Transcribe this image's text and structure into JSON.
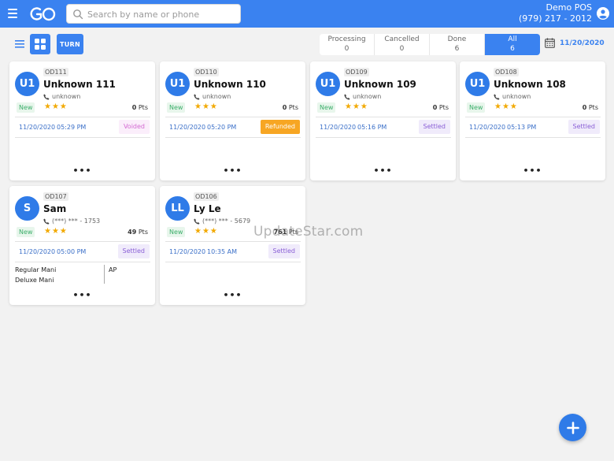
{
  "header": {
    "search_placeholder": "Search by name or phone",
    "store_name": "Demo POS",
    "store_phone": "(979) 217 - 2012"
  },
  "toolbar": {
    "turn_label": "TURN",
    "tabs": [
      {
        "label": "Processing",
        "count": "0"
      },
      {
        "label": "Cancelled",
        "count": "0"
      },
      {
        "label": "Done",
        "count": "6"
      },
      {
        "label": "All",
        "count": "6"
      }
    ],
    "date": "11/20/2020"
  },
  "orders": [
    {
      "initials": "U1",
      "id": "OD111",
      "name": "Unknown 111",
      "phone": "unknown",
      "tag": "New",
      "stars": "★★★",
      "points": "0",
      "points_unit": "Pts",
      "date": "11/20/2020",
      "time": "05:29 PM",
      "status": "Voided"
    },
    {
      "initials": "U1",
      "id": "OD110",
      "name": "Unknown 110",
      "phone": "unknown",
      "tag": "New",
      "stars": "★★★",
      "points": "0",
      "points_unit": "Pts",
      "date": "11/20/2020",
      "time": "05:20 PM",
      "status": "Refunded"
    },
    {
      "initials": "U1",
      "id": "OD109",
      "name": "Unknown 109",
      "phone": "unknown",
      "tag": "New",
      "stars": "★★★",
      "points": "0",
      "points_unit": "Pts",
      "date": "11/20/2020",
      "time": "05:16 PM",
      "status": "Settled"
    },
    {
      "initials": "U1",
      "id": "OD108",
      "name": "Unknown 108",
      "phone": "unknown",
      "tag": "New",
      "stars": "★★★",
      "points": "0",
      "points_unit": "Pts",
      "date": "11/20/2020",
      "time": "05:13 PM",
      "status": "Settled"
    },
    {
      "initials": "S",
      "id": "OD107",
      "name": "Sam",
      "phone": "(***) *** - 1753",
      "tag": "New",
      "stars": "★★★",
      "points": "49",
      "points_unit": "Pts",
      "date": "11/20/2020",
      "time": "05:00 PM",
      "status": "Settled",
      "services": [
        "Regular Mani",
        "Deluxe Mani"
      ],
      "staff": "AP"
    },
    {
      "initials": "LL",
      "id": "OD106",
      "name": "Ly Le",
      "phone": "(***) *** - 5679",
      "tag": "New",
      "stars": "★★★",
      "points": "761",
      "points_unit": "Pts",
      "date": "11/20/2020",
      "time": "10:35 AM",
      "status": "Settled"
    }
  ],
  "watermark": "UpdateStar.com",
  "more_label": "•••",
  "colors": {
    "primary": "#3a82f0",
    "voided": "#d36ad2",
    "refunded": "#f7a623",
    "settled": "#8a5fd6",
    "new": "#3cae6a"
  }
}
